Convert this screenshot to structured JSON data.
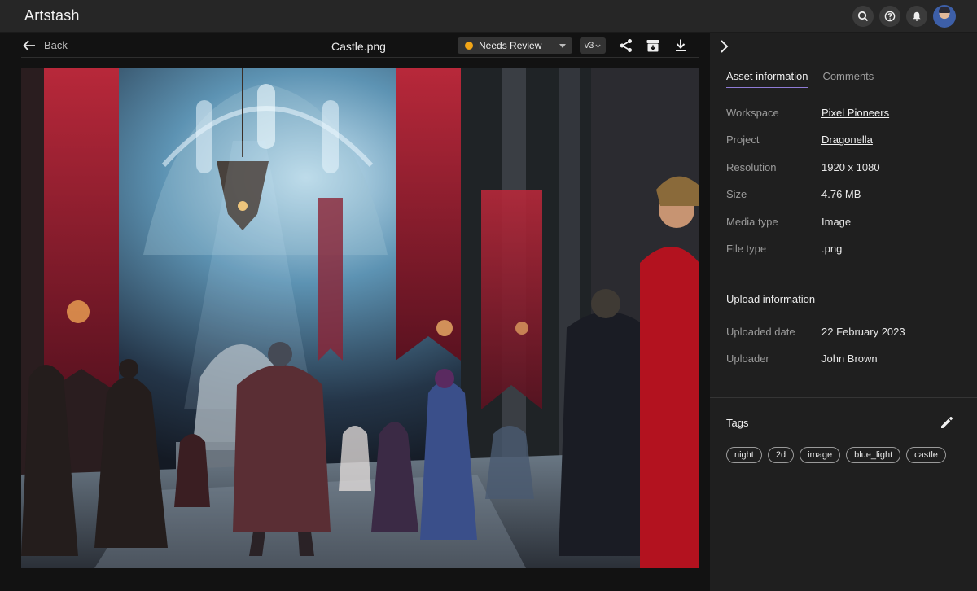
{
  "app": {
    "title": "Artstash"
  },
  "header": {
    "icons": [
      "search-icon",
      "help-icon",
      "bell-icon"
    ],
    "avatar": "user-avatar"
  },
  "viewer": {
    "back_label": "Back",
    "filename": "Castle.png",
    "status": {
      "label": "Needs Review",
      "color": "#f2a516"
    },
    "version": "v3",
    "toolbar_icons": [
      "share-icon",
      "archive-icon",
      "download-icon"
    ]
  },
  "panel": {
    "tabs": [
      {
        "label": "Asset information",
        "active": true
      },
      {
        "label": "Comments",
        "active": false
      }
    ],
    "asset_info": [
      {
        "key": "Workspace",
        "value": "Pixel Pioneers",
        "link": true
      },
      {
        "key": "Project",
        "value": "Dragonella",
        "link": true
      },
      {
        "key": "Resolution",
        "value": "1920 x 1080",
        "link": false
      },
      {
        "key": "Size",
        "value": "4.76 MB",
        "link": false
      },
      {
        "key": "Media type",
        "value": "Image",
        "link": false
      },
      {
        "key": "File type",
        "value": ".png",
        "link": false
      }
    ],
    "upload": {
      "title": "Upload information",
      "rows": [
        {
          "key": "Uploaded date",
          "value": "22 February 2023"
        },
        {
          "key": "Uploader",
          "value": "John Brown"
        }
      ]
    },
    "tags": {
      "title": "Tags",
      "items": [
        "night",
        "2d",
        "image",
        "blue_light",
        "castle"
      ]
    }
  }
}
